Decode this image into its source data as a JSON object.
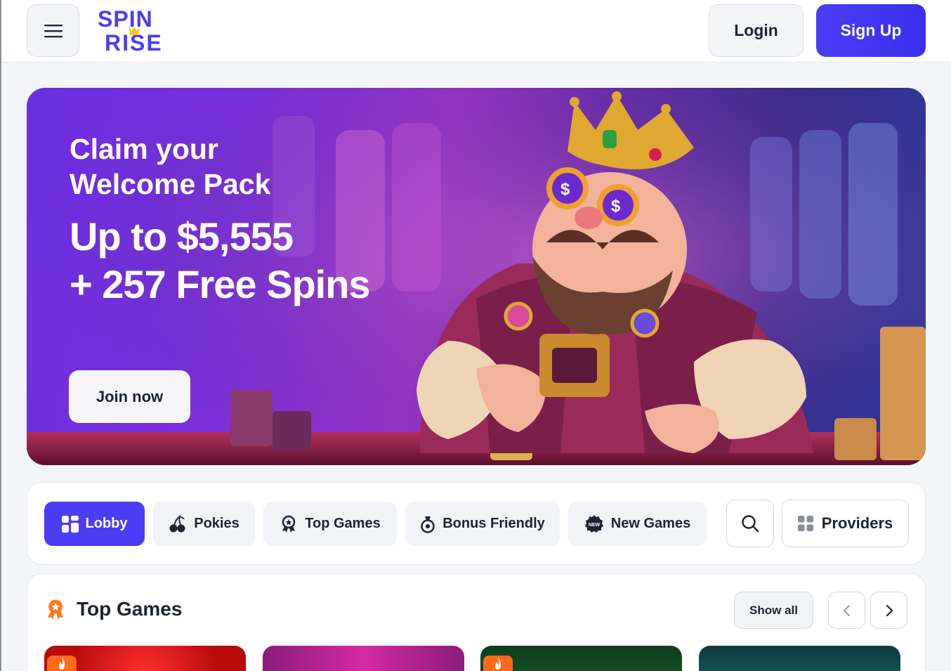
{
  "header": {
    "logo_text_top": "SPIN",
    "logo_text_bottom": "RISE",
    "login_label": "Login",
    "signup_label": "Sign Up"
  },
  "hero": {
    "title_line1": "Claim your",
    "title_line2": "Welcome Pack",
    "amount_line1": "Up to $5,555",
    "amount_line2": "+ 257 Free Spins",
    "cta_label": "Join now"
  },
  "categories": {
    "items": [
      {
        "label": "Lobby",
        "icon": "grid-icon",
        "active": true
      },
      {
        "label": "Pokies",
        "icon": "cherries-icon",
        "active": false
      },
      {
        "label": "Top Games",
        "icon": "award-icon",
        "active": false
      },
      {
        "label": "Bonus Friendly",
        "icon": "money-bag-icon",
        "active": false
      },
      {
        "label": "New Games",
        "icon": "new-badge-icon",
        "active": false
      }
    ],
    "providers_label": "Providers",
    "new_badge_text": "NEW"
  },
  "top_games": {
    "title": "Top Games",
    "show_all_label": "Show all"
  },
  "colors": {
    "accent": "#4a3df5",
    "hot_badge": "#ff6a1a",
    "award_icon": "#ff7a1a"
  }
}
